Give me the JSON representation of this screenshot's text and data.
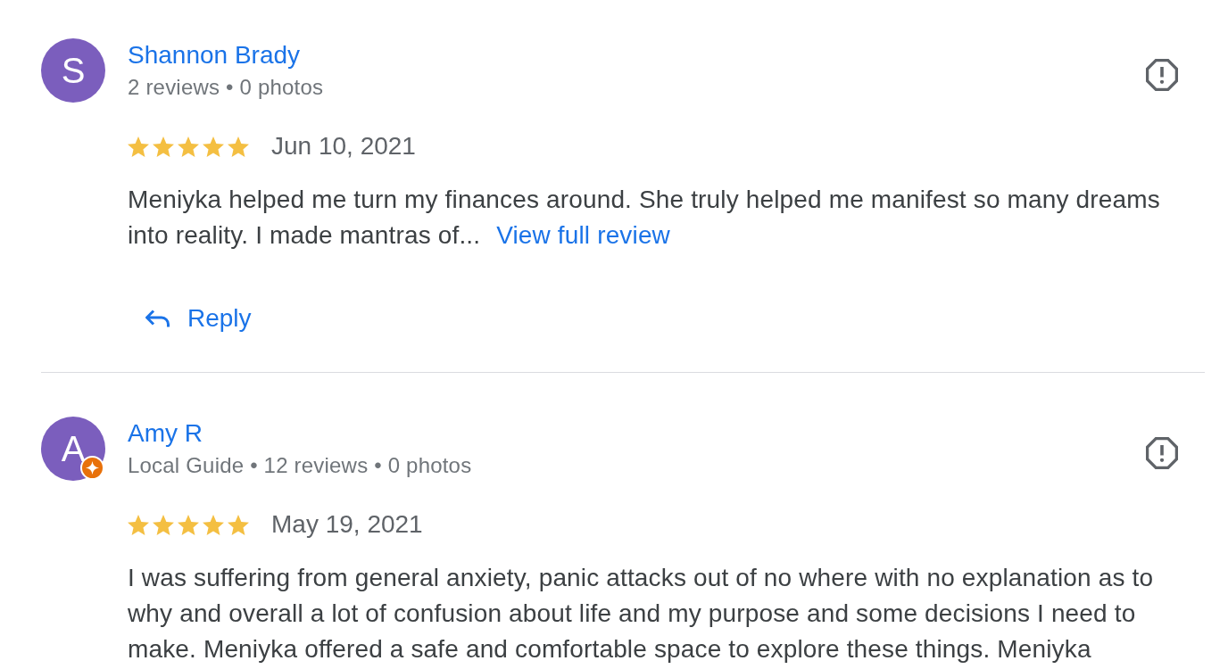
{
  "reviews": [
    {
      "avatar_letter": "S",
      "local_guide": false,
      "name": "Shannon Brady",
      "meta": "2 reviews • 0 photos",
      "stars": 5,
      "date": "Jun 10, 2021",
      "text": "Meniyka helped me turn my finances around. She truly helped me manifest so many dreams into reality. I made mantras of...",
      "more_link": "View full review",
      "reply_label": "Reply"
    },
    {
      "avatar_letter": "A",
      "local_guide": true,
      "name": "Amy R",
      "meta": "Local Guide • 12 reviews • 0 photos",
      "stars": 5,
      "date": "May 19, 2021",
      "text": "I was suffering from general anxiety, panic attacks out of no where with no explanation as to why and overall a lot of confusion about life and my purpose and some decisions I need to make. Meniyka offered a safe and comfortable space to explore these things. Meniyka"
    }
  ]
}
